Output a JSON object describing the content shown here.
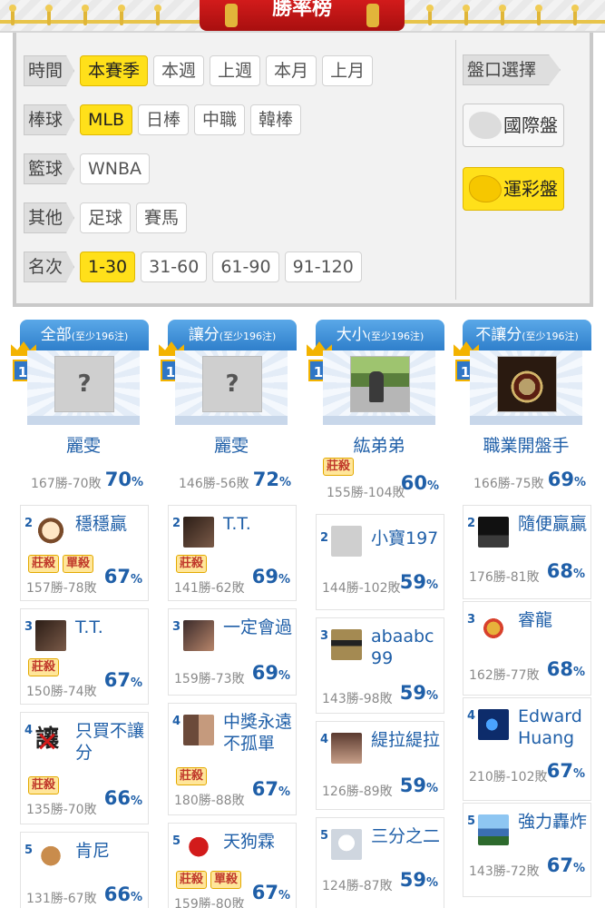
{
  "header": {
    "title": "勝率榜"
  },
  "filters": {
    "time": {
      "label": "時間",
      "options": [
        "本賽季",
        "本週",
        "上週",
        "本月",
        "上月"
      ],
      "selected": "本賽季"
    },
    "baseball": {
      "label": "棒球",
      "options": [
        "MLB",
        "日棒",
        "中職",
        "韓棒"
      ],
      "selected": "MLB"
    },
    "basketball": {
      "label": "籃球",
      "options": [
        "WNBA"
      ],
      "selected": ""
    },
    "other": {
      "label": "其他",
      "options": [
        "足球",
        "賽馬"
      ],
      "selected": ""
    },
    "rank": {
      "label": "名次",
      "options": [
        "1-30",
        "31-60",
        "61-90",
        "91-120"
      ],
      "selected": "1-30"
    },
    "market": {
      "label": "盤口選擇",
      "international": "國際盤",
      "lottery": "運彩盤",
      "selected": "運彩盤"
    }
  },
  "columns": [
    {
      "title": "全部",
      "subtitle": "(至少196注)",
      "top": {
        "rank": "1",
        "name": "麗雯",
        "record": "167勝-70敗",
        "pct": "70",
        "unit": "%",
        "tags": []
      },
      "entries": [
        {
          "rank": "2",
          "name": "穩穩贏",
          "record": "157勝-78敗",
          "pct": "67",
          "unit": "%",
          "tags": [
            "莊殺",
            "單殺"
          ]
        },
        {
          "rank": "3",
          "name": "T.T.",
          "record": "150勝-74敗",
          "pct": "67",
          "unit": "%",
          "tags": [
            "莊殺"
          ]
        },
        {
          "rank": "4",
          "name": "只買不讓分",
          "record": "135勝-70敗",
          "pct": "66",
          "unit": "%",
          "tags": [
            "莊殺"
          ],
          "avatar_text": "讓"
        },
        {
          "rank": "5",
          "name": "肯尼",
          "record": "131勝-67敗",
          "pct": "66",
          "unit": "%",
          "tags": []
        }
      ]
    },
    {
      "title": "讓分",
      "subtitle": "(至少196注)",
      "top": {
        "rank": "1",
        "name": "麗雯",
        "record": "146勝-56敗",
        "pct": "72",
        "unit": "%",
        "tags": []
      },
      "entries": [
        {
          "rank": "2",
          "name": "T.T.",
          "record": "141勝-62敗",
          "pct": "69",
          "unit": "%",
          "tags": [
            "莊殺"
          ]
        },
        {
          "rank": "3",
          "name": "一定會過",
          "record": "159勝-73敗",
          "pct": "69",
          "unit": "%",
          "tags": []
        },
        {
          "rank": "4",
          "name": "中獎永遠不孤單",
          "record": "180勝-88敗",
          "pct": "67",
          "unit": "%",
          "tags": [
            "莊殺"
          ]
        },
        {
          "rank": "5",
          "name": "天狗霖",
          "record": "159勝-80敗",
          "pct": "67",
          "unit": "%",
          "tags": [
            "莊殺",
            "單殺"
          ]
        }
      ]
    },
    {
      "title": "大小",
      "subtitle": "(至少196注)",
      "top": {
        "rank": "1",
        "name": "紘弟弟",
        "record": "155勝-104敗",
        "pct": "60",
        "unit": "%",
        "tags": [
          "莊殺"
        ]
      },
      "entries": [
        {
          "rank": "2",
          "name": "小寶197",
          "record": "144勝-102敗",
          "pct": "59",
          "unit": "%",
          "tags": []
        },
        {
          "rank": "3",
          "name": "abaabc99",
          "record": "143勝-98敗",
          "pct": "59",
          "unit": "%",
          "tags": []
        },
        {
          "rank": "4",
          "name": "緹拉緹拉",
          "record": "126勝-89敗",
          "pct": "59",
          "unit": "%",
          "tags": []
        },
        {
          "rank": "5",
          "name": "三分之二",
          "record": "124勝-87敗",
          "pct": "59",
          "unit": "%",
          "tags": []
        }
      ]
    },
    {
      "title": "不讓分",
      "subtitle": "(至少196注)",
      "top": {
        "rank": "1",
        "name": "職業開盤手",
        "record": "166勝-75敗",
        "pct": "69",
        "unit": "%",
        "tags": []
      },
      "entries": [
        {
          "rank": "2",
          "name": "隨便贏贏",
          "record": "176勝-81敗",
          "pct": "68",
          "unit": "%",
          "tags": []
        },
        {
          "rank": "3",
          "name": "睿龍",
          "record": "162勝-77敗",
          "pct": "68",
          "unit": "%",
          "tags": []
        },
        {
          "rank": "4",
          "name": "EdwardHuang",
          "record": "210勝-102敗",
          "pct": "67",
          "unit": "%",
          "tags": []
        },
        {
          "rank": "5",
          "name": "強力轟炸",
          "record": "143勝-72敗",
          "pct": "67",
          "unit": "%",
          "tags": []
        }
      ]
    }
  ]
}
